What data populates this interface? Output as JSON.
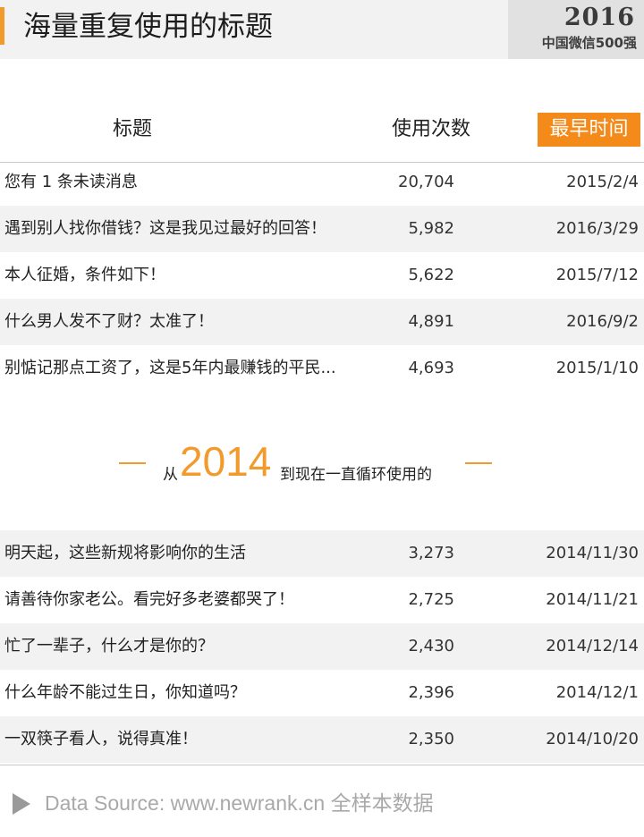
{
  "header": {
    "title": "海量重复使用的标题",
    "brand_year": "2016",
    "brand_text": "中国微信500强"
  },
  "columns": {
    "title": "标题",
    "count": "使用次数",
    "earliest": "最早时间"
  },
  "rows_a": [
    {
      "title": "您有 1 条未读消息",
      "count": "20,704",
      "date": "2015/2/4"
    },
    {
      "title": "遇到别人找你借钱？这是我见过最好的回答！",
      "count": "5,982",
      "date": "2016/3/29"
    },
    {
      "title": "本人征婚，条件如下！",
      "count": "5,622",
      "date": "2015/7/12"
    },
    {
      "title": "什么男人发不了财？太准了！",
      "count": "4,891",
      "date": "2016/9/2"
    },
    {
      "title": "别惦记那点工资了，这是5年内最赚钱的平民...",
      "count": "4,693",
      "date": "2015/1/10"
    }
  ],
  "section": {
    "prefix": "从",
    "year": "2014",
    "suffix": "到现在一直循环使用的"
  },
  "rows_b": [
    {
      "title": "明天起，这些新规将影响你的生活",
      "count": "3,273",
      "date": "2014/11/30"
    },
    {
      "title": "请善待你家老公。看完好多老婆都哭了！",
      "count": "2,725",
      "date": "2014/11/21"
    },
    {
      "title": "忙了一辈子，什么才是你的？",
      "count": "2,430",
      "date": "2014/12/14"
    },
    {
      "title": "什么年龄不能过生日，你知道吗？",
      "count": "2,396",
      "date": "2014/12/1"
    },
    {
      "title": "一双筷子看人，说得真准！",
      "count": "2,350",
      "date": "2014/10/20"
    }
  ],
  "footer": {
    "source": "Data Source: www.newrank.cn  全样本数据",
    "icon": "play-icon"
  },
  "colors": {
    "accent": "#f39a2c",
    "highlight_bg": "#f38a1a",
    "row_shade": "#f2f2f2"
  }
}
